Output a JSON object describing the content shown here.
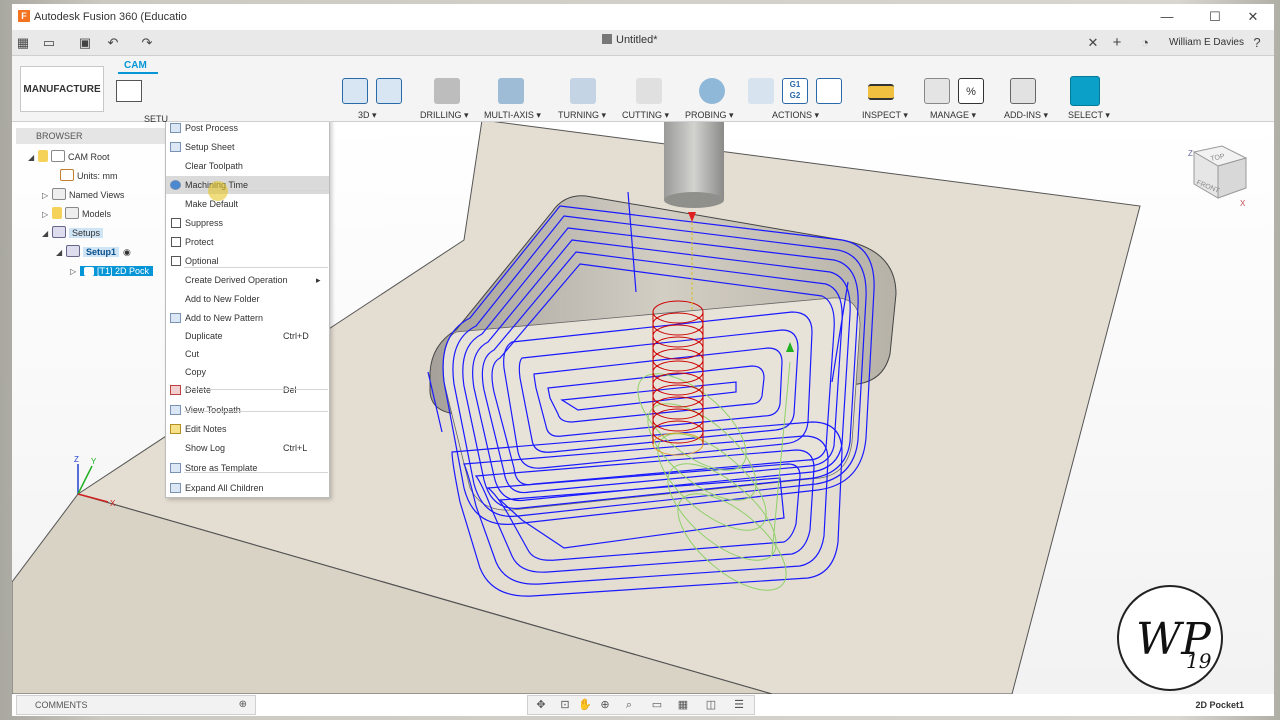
{
  "window": {
    "app_title": "Autodesk Fusion 360 (Educatio",
    "logo_letter": "F",
    "document_tab": "Untitled*",
    "user": "William E Davies",
    "minimize": "—",
    "maximize": "☐",
    "close": "✕",
    "tab_close": "✕",
    "new_tab": "+"
  },
  "ribbon": {
    "workspace": "MANUFACTURE ▾",
    "active_tab": "CAM",
    "setup_label": "SETU",
    "groups": [
      "3D ▾",
      "DRILLING ▾",
      "MULTI-AXIS ▾",
      "TURNING ▾",
      "CUTTING ▾",
      "PROBING ▾",
      "ACTIONS ▾",
      "INSPECT ▾",
      "MANAGE ▾",
      "ADD-INS ▾",
      "SELECT ▾"
    ],
    "g1g2_line1": "G1",
    "g1g2_line2": "G2",
    "percent": "%"
  },
  "browser": {
    "header": "BROWSER",
    "items": [
      {
        "label": "CAM Root"
      },
      {
        "label": "Units: mm"
      },
      {
        "label": "Named Views"
      },
      {
        "label": "Models"
      },
      {
        "label": "Setups"
      },
      {
        "label": "Setup1"
      },
      {
        "label": "[T1] 2D Pock"
      }
    ]
  },
  "context_menu": {
    "items": [
      {
        "label": "Post Process",
        "shortcut": ""
      },
      {
        "label": "Setup Sheet",
        "shortcut": ""
      },
      {
        "label": "Clear Toolpath",
        "shortcut": ""
      },
      {
        "label": "Machining Time",
        "shortcut": ""
      },
      {
        "label": "Make Default",
        "shortcut": ""
      },
      {
        "label": "Suppress",
        "shortcut": ""
      },
      {
        "label": "Protect",
        "shortcut": ""
      },
      {
        "label": "Optional",
        "shortcut": ""
      },
      {
        "label": "Create Derived Operation",
        "shortcut": "▸"
      },
      {
        "label": "Add to New Folder",
        "shortcut": ""
      },
      {
        "label": "Add to New Pattern",
        "shortcut": ""
      },
      {
        "label": "Duplicate",
        "shortcut": "Ctrl+D"
      },
      {
        "label": "Cut",
        "shortcut": ""
      },
      {
        "label": "Copy",
        "shortcut": ""
      },
      {
        "label": "Delete",
        "shortcut": "Del"
      },
      {
        "label": "View Toolpath",
        "shortcut": ""
      },
      {
        "label": "Edit Notes",
        "shortcut": ""
      },
      {
        "label": "Show Log",
        "shortcut": "Ctrl+L"
      },
      {
        "label": "Store as Template",
        "shortcut": ""
      },
      {
        "label": "Expand All Children",
        "shortcut": ""
      }
    ]
  },
  "viewcube": {
    "top": "TOP",
    "front": "FRONT",
    "x": "X",
    "z": "Z"
  },
  "triad": {
    "x": "X",
    "y": "Y",
    "z": "Z"
  },
  "comments": {
    "label": "COMMENTS",
    "add": "⊕"
  },
  "status": {
    "operation": "2D Pocket1"
  },
  "watermark": {
    "text": "WP",
    "number": "19"
  },
  "colors": {
    "accent": "#0696d7",
    "model": "#e3ddd1",
    "toolpath": "#1a1aff",
    "lead": "#cc0000",
    "ramp": "#8fd06a"
  }
}
